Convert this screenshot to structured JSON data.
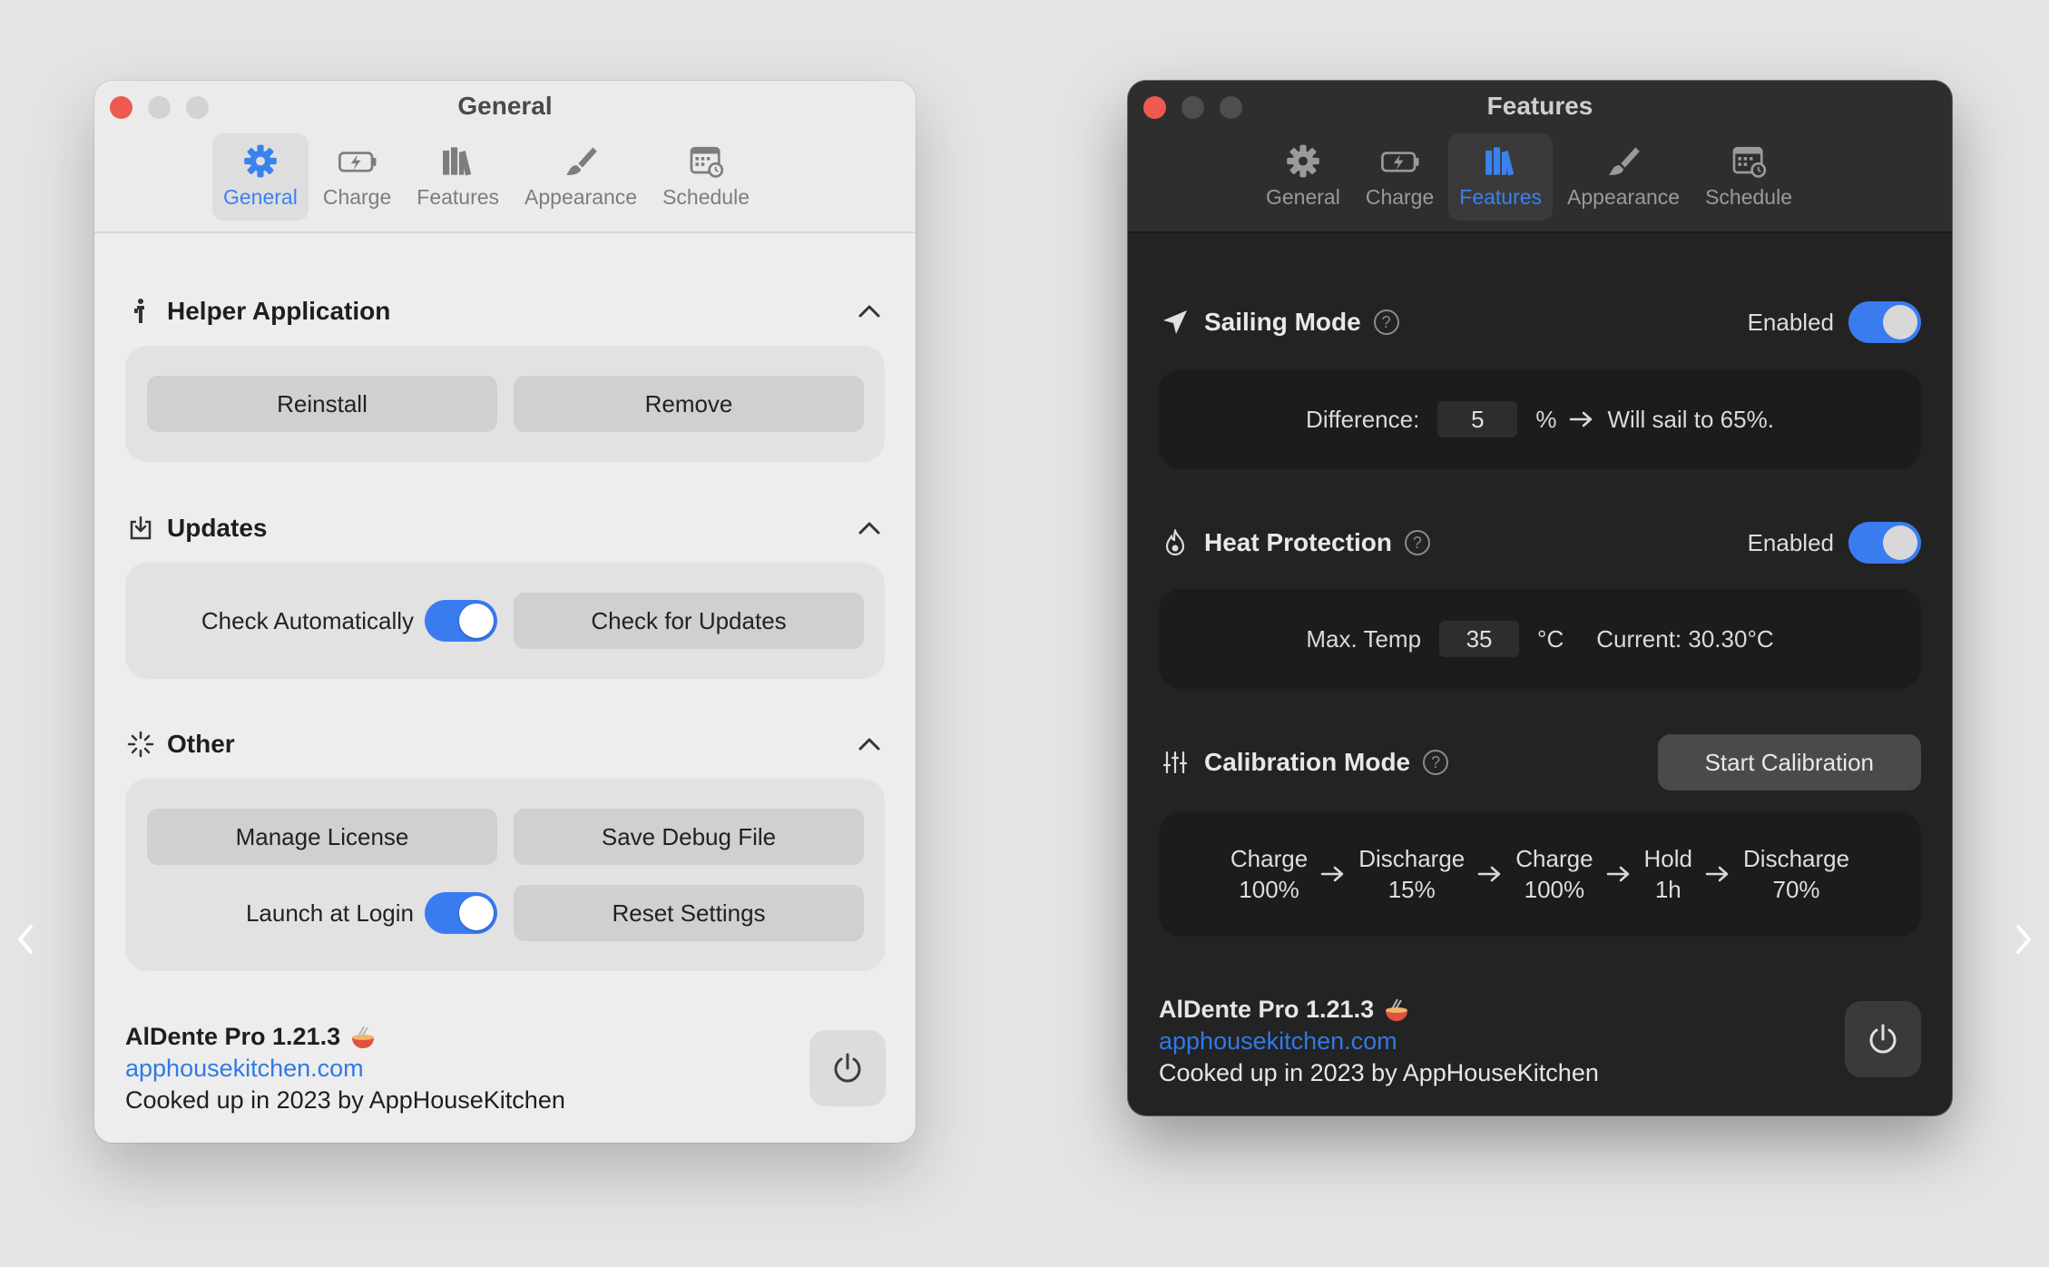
{
  "light_window": {
    "title": "General",
    "tabs": [
      "General",
      "Charge",
      "Features",
      "Appearance",
      "Schedule"
    ],
    "active_tab": "General",
    "sections": {
      "helper": {
        "title": "Helper Application",
        "reinstall": "Reinstall",
        "remove": "Remove"
      },
      "updates": {
        "title": "Updates",
        "check_auto_label": "Check Automatically",
        "check_auto_on": true,
        "check_updates": "Check for Updates"
      },
      "other": {
        "title": "Other",
        "manage_license": "Manage License",
        "save_debug": "Save Debug File",
        "launch_login_label": "Launch at Login",
        "launch_login_on": true,
        "reset_settings": "Reset Settings"
      }
    },
    "footer": {
      "app_name": "AlDente Pro 1.21.3",
      "link": "apphousekitchen.com",
      "credit": "Cooked up in 2023 by AppHouseKitchen"
    }
  },
  "dark_window": {
    "title": "Features",
    "tabs": [
      "General",
      "Charge",
      "Features",
      "Appearance",
      "Schedule"
    ],
    "active_tab": "Features",
    "sailing": {
      "title": "Sailing Mode",
      "help": "?",
      "status": "Enabled",
      "on": true,
      "difference_label": "Difference:",
      "difference_value": "5",
      "unit": "%",
      "result": "Will sail to 65%."
    },
    "heat": {
      "title": "Heat Protection",
      "help": "?",
      "status": "Enabled",
      "on": true,
      "max_label": "Max. Temp",
      "max_value": "35",
      "unit": "°C",
      "current": "Current: 30.30°C"
    },
    "calibration": {
      "title": "Calibration Mode",
      "help": "?",
      "start_button": "Start Calibration",
      "steps": [
        {
          "action": "Charge",
          "value": "100%"
        },
        {
          "action": "Discharge",
          "value": "15%"
        },
        {
          "action": "Charge",
          "value": "100%"
        },
        {
          "action": "Hold",
          "value": "1h"
        },
        {
          "action": "Discharge",
          "value": "70%"
        }
      ]
    },
    "footer": {
      "app_name": "AlDente Pro 1.21.3",
      "link": "apphousekitchen.com",
      "credit": "Cooked up in 2023 by AppHouseKitchen"
    }
  },
  "colors": {
    "accent": "#3a7cf0",
    "link": "#2f7ae5",
    "close": "#ee5a52"
  }
}
